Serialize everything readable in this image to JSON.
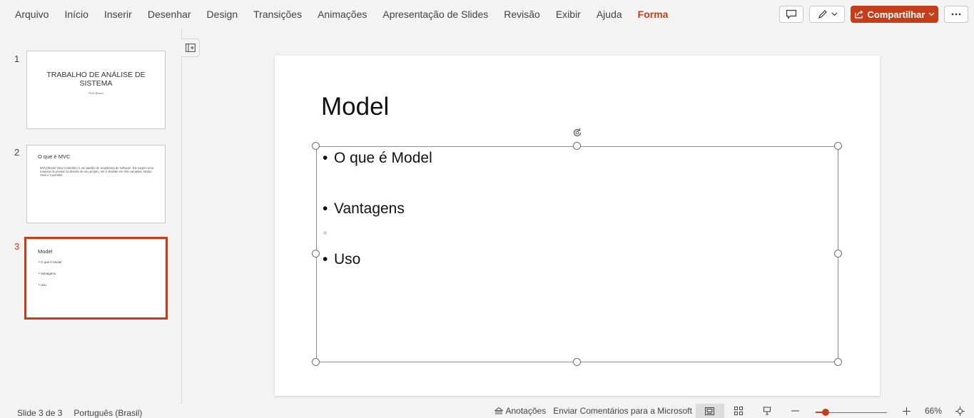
{
  "menu": {
    "items": [
      {
        "label": "Arquivo"
      },
      {
        "label": "Início"
      },
      {
        "label": "Inserir"
      },
      {
        "label": "Desenhar"
      },
      {
        "label": "Design"
      },
      {
        "label": "Transições"
      },
      {
        "label": "Animações"
      },
      {
        "label": "Apresentação de Slides"
      },
      {
        "label": "Revisão"
      },
      {
        "label": "Exibir"
      },
      {
        "label": "Ajuda"
      },
      {
        "label": "Forma"
      }
    ],
    "active_index": 11,
    "share_label": "Compartilhar",
    "accent_color": "#c43e1c"
  },
  "thumbnails": [
    {
      "number": "1",
      "title": "TRABALHO DE ANÁLISE DE SISTEMA",
      "subtitle": "Prof: Bruno"
    },
    {
      "number": "2",
      "title": "O que é MVC",
      "body": "MVC(Model View Controller) é um padrão de arquitetura de software. Ele sugere uma maneira de pensar na divisão de seu projeto, ele é dividido em três camadas, Model, View e Controller."
    },
    {
      "number": "3",
      "title": "Model",
      "bullets": [
        "O que é Model",
        "Vantagens",
        "Uso"
      ]
    }
  ],
  "selected_slide": 3,
  "slide": {
    "title": "Model",
    "bullets": [
      "O que é Model",
      "Vantagens",
      "Uso"
    ]
  },
  "status": {
    "slide_position": "Slide 3 de 3",
    "language": "Português (Brasil)",
    "notes_label": "Anotações",
    "feedback_label": "Enviar Comentários para a Microsoft",
    "zoom": "66%",
    "zoom_fraction": 0.14
  }
}
